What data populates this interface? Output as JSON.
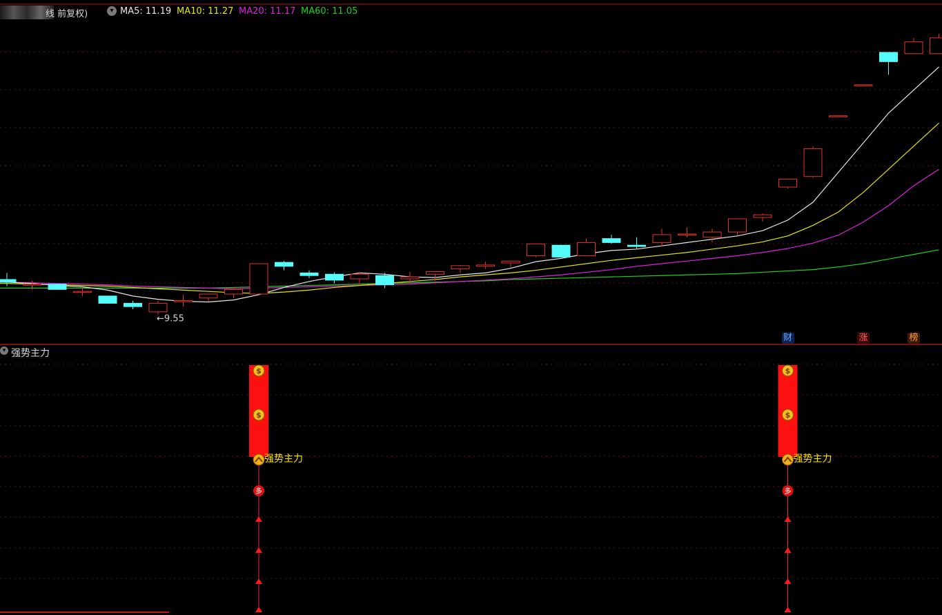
{
  "header": {
    "period_label": "线 前复权)",
    "ma_items": [
      {
        "label": "MA5: 11.19",
        "color": "#e8e8e8"
      },
      {
        "label": "MA10: 11.27",
        "color": "#e6e600"
      },
      {
        "label": "MA20: 11.17",
        "color": "#e01ee0"
      },
      {
        "label": "MA60: 11.05",
        "color": "#1ed21e"
      }
    ]
  },
  "colors": {
    "up": "#e8302a",
    "down": "#54fcfc",
    "ma5": "#e8e8e8",
    "ma10": "#e6e600",
    "ma20": "#e01ee0",
    "ma60": "#1ed21e",
    "grid": "#6a1010",
    "panel_border": "#a01818",
    "signal_bar": "#ff1010",
    "indicator_label": "#ffe400"
  },
  "chart_data": {
    "type": "candlestick",
    "low_marker": "9.55",
    "candles": [
      {
        "o": 10.08,
        "h": 10.18,
        "l": 9.98,
        "c": 10.04
      },
      {
        "o": 10.01,
        "h": 10.06,
        "l": 9.93,
        "c": 10.01
      },
      {
        "o": 10.01,
        "h": 10.01,
        "l": 9.93,
        "c": 9.93
      },
      {
        "o": 9.9,
        "h": 9.95,
        "l": 9.83,
        "c": 9.9
      },
      {
        "o": 9.83,
        "h": 9.83,
        "l": 9.72,
        "c": 9.72
      },
      {
        "o": 9.72,
        "h": 9.76,
        "l": 9.63,
        "c": 9.67
      },
      {
        "o": 9.59,
        "h": 9.76,
        "l": 9.55,
        "c": 9.72
      },
      {
        "o": 9.76,
        "h": 9.85,
        "l": 9.67,
        "c": 9.76
      },
      {
        "o": 9.8,
        "h": 9.86,
        "l": 9.75,
        "c": 9.86
      },
      {
        "o": 9.86,
        "h": 9.96,
        "l": 9.8,
        "c": 9.93
      },
      {
        "o": 9.86,
        "h": 10.32,
        "l": 9.86,
        "c": 10.32
      },
      {
        "o": 10.34,
        "h": 10.36,
        "l": 10.22,
        "c": 10.28
      },
      {
        "o": 10.18,
        "h": 10.22,
        "l": 10.1,
        "c": 10.14
      },
      {
        "o": 10.16,
        "h": 10.19,
        "l": 10.02,
        "c": 10.07
      },
      {
        "o": 10.09,
        "h": 10.19,
        "l": 10.0,
        "c": 10.16
      },
      {
        "o": 10.14,
        "h": 10.18,
        "l": 9.95,
        "c": 10.0
      },
      {
        "o": 10.09,
        "h": 10.2,
        "l": 10.02,
        "c": 10.12
      },
      {
        "o": 10.16,
        "h": 10.2,
        "l": 10.06,
        "c": 10.2
      },
      {
        "o": 10.24,
        "h": 10.3,
        "l": 10.18,
        "c": 10.29
      },
      {
        "o": 10.28,
        "h": 10.35,
        "l": 10.24,
        "c": 10.3
      },
      {
        "o": 10.33,
        "h": 10.36,
        "l": 10.26,
        "c": 10.36
      },
      {
        "o": 10.44,
        "h": 10.62,
        "l": 10.42,
        "c": 10.62
      },
      {
        "o": 10.6,
        "h": 10.6,
        "l": 10.42,
        "c": 10.42
      },
      {
        "o": 10.44,
        "h": 10.7,
        "l": 10.44,
        "c": 10.64
      },
      {
        "o": 10.7,
        "h": 10.76,
        "l": 10.62,
        "c": 10.64
      },
      {
        "o": 10.6,
        "h": 10.72,
        "l": 10.55,
        "c": 10.58
      },
      {
        "o": 10.64,
        "h": 10.85,
        "l": 10.58,
        "c": 10.76
      },
      {
        "o": 10.77,
        "h": 10.87,
        "l": 10.72,
        "c": 10.77
      },
      {
        "o": 10.72,
        "h": 10.85,
        "l": 10.64,
        "c": 10.8
      },
      {
        "o": 10.8,
        "h": 11.0,
        "l": 10.75,
        "c": 11.0
      },
      {
        "o": 11.02,
        "h": 11.08,
        "l": 10.96,
        "c": 11.06
      },
      {
        "o": 11.48,
        "h": 11.5,
        "l": 11.46,
        "c": 11.6
      },
      {
        "o": 11.64,
        "h": 12.1,
        "l": 11.62,
        "c": 12.06
      },
      {
        "o": 12.56,
        "h": 12.56,
        "l": 12.56,
        "c": 12.56
      },
      {
        "o": 13.03,
        "h": 13.03,
        "l": 13.03,
        "c": 13.03
      },
      {
        "o": 13.52,
        "h": 13.52,
        "l": 13.18,
        "c": 13.38
      },
      {
        "o": 13.5,
        "h": 13.74,
        "l": 13.5,
        "c": 13.68
      },
      {
        "o": 13.5,
        "h": 13.8,
        "l": 13.5,
        "c": 13.74
      }
    ],
    "ma5": [
      10.04,
      10.02,
      9.99,
      9.97,
      9.92,
      9.83,
      9.78,
      9.75,
      9.74,
      9.77,
      9.85,
      9.96,
      10.05,
      10.12,
      10.18,
      10.16,
      10.12,
      10.11,
      10.15,
      10.18,
      10.25,
      10.35,
      10.4,
      10.47,
      10.52,
      10.54,
      10.59,
      10.64,
      10.69,
      10.74,
      10.82,
      10.98,
      11.25,
      11.7,
      12.15,
      12.6,
      12.95,
      13.3
    ],
    "ma10": [
      10.02,
      10.01,
      10.0,
      9.99,
      9.98,
      9.96,
      9.94,
      9.92,
      9.9,
      9.88,
      9.87,
      9.89,
      9.92,
      9.96,
      9.99,
      10.02,
      10.05,
      10.08,
      10.12,
      10.15,
      10.18,
      10.22,
      10.27,
      10.32,
      10.37,
      10.41,
      10.45,
      10.49,
      10.54,
      10.59,
      10.65,
      10.74,
      10.9,
      11.1,
      11.4,
      11.75,
      12.1,
      12.45
    ],
    "ma20": [
      10.04,
      10.03,
      10.02,
      10.01,
      10.0,
      9.98,
      9.97,
      9.96,
      9.95,
      9.94,
      9.95,
      9.96,
      9.97,
      9.98,
      9.99,
      10.0,
      10.01,
      10.03,
      10.05,
      10.07,
      10.09,
      10.12,
      10.15,
      10.19,
      10.23,
      10.28,
      10.32,
      10.36,
      10.4,
      10.44,
      10.49,
      10.55,
      10.63,
      10.75,
      10.95,
      11.2,
      11.5,
      11.75
    ],
    "ma60": [
      9.95,
      9.95,
      9.95,
      9.95,
      9.95,
      9.95,
      9.95,
      9.95,
      9.95,
      9.96,
      9.97,
      9.98,
      9.99,
      10.0,
      10.01,
      10.02,
      10.03,
      10.04,
      10.05,
      10.06,
      10.08,
      10.09,
      10.1,
      10.11,
      10.12,
      10.13,
      10.14,
      10.15,
      10.16,
      10.17,
      10.19,
      10.21,
      10.23,
      10.27,
      10.32,
      10.39,
      10.46,
      10.53
    ],
    "ylim": [
      9.4,
      14.0
    ]
  },
  "event_tags": [
    {
      "label": "财",
      "candle": 31,
      "color": "#6aa8ff",
      "bg": "#0c2250"
    },
    {
      "label": "涨",
      "candle": 34,
      "color": "#ff5a5a",
      "bg": "#3a0808"
    },
    {
      "label": "榜",
      "candle": 36,
      "color": "#ff9a30",
      "bg": "#3a1a04"
    }
  ],
  "indicator": {
    "title": "强势主力",
    "signals": [
      {
        "candle": 10,
        "label": "强势主力",
        "bag_symbol": "$",
        "badge_symbol": "多"
      },
      {
        "candle": 31,
        "label": "强势主力",
        "bag_symbol": "$",
        "badge_symbol": "多"
      }
    ]
  }
}
